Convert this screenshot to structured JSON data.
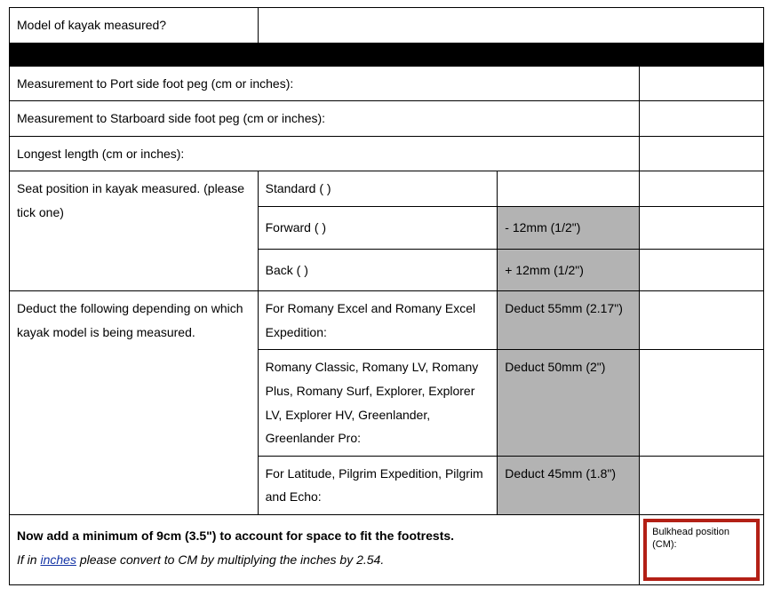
{
  "row_model": {
    "label": "Model of kayak measured?",
    "value": ""
  },
  "row_port": {
    "label": "Measurement to Port side foot peg (cm or inches):",
    "value": ""
  },
  "row_starboard": {
    "label": "Measurement to Starboard side foot peg (cm or inches):",
    "value": ""
  },
  "row_longest": {
    "label": "Longest length (cm or inches):",
    "value": ""
  },
  "seat": {
    "label": "Seat position in kayak measured. (please tick one)",
    "options": {
      "standard": {
        "label": "Standard   (   )",
        "adjust": ""
      },
      "forward": {
        "label": "Forward    (   )",
        "adjust": "- 12mm (1/2\")"
      },
      "back": {
        "label": "Back         (   )",
        "adjust": "+ 12mm (1/2\")"
      }
    }
  },
  "deduct": {
    "label": "Deduct the following depending on which kayak model is being measured.",
    "group1": {
      "models": "For Romany Excel and Romany Excel Expedition:",
      "amount": "Deduct 55mm (2.17\")"
    },
    "group2": {
      "models": "Romany Classic, Romany LV, Romany Plus, Romany Surf, Explorer, Explorer LV, Explorer HV, Greenlander, Greenlander Pro:",
      "amount": "Deduct 50mm (2\")"
    },
    "group3": {
      "models": "For Latitude, Pilgrim Expedition, Pilgrim and Echo:",
      "amount": "Deduct 45mm (1.8\")"
    }
  },
  "footrest": {
    "line1": "Now add a minimum of 9cm (3.5\") to account for space to fit the footrests.",
    "line2a": "If in ",
    "line2b": "inches",
    "line2c": " please convert to CM by multiplying the inches by 2.54."
  },
  "result": {
    "label": "Bulkhead position (CM):"
  }
}
